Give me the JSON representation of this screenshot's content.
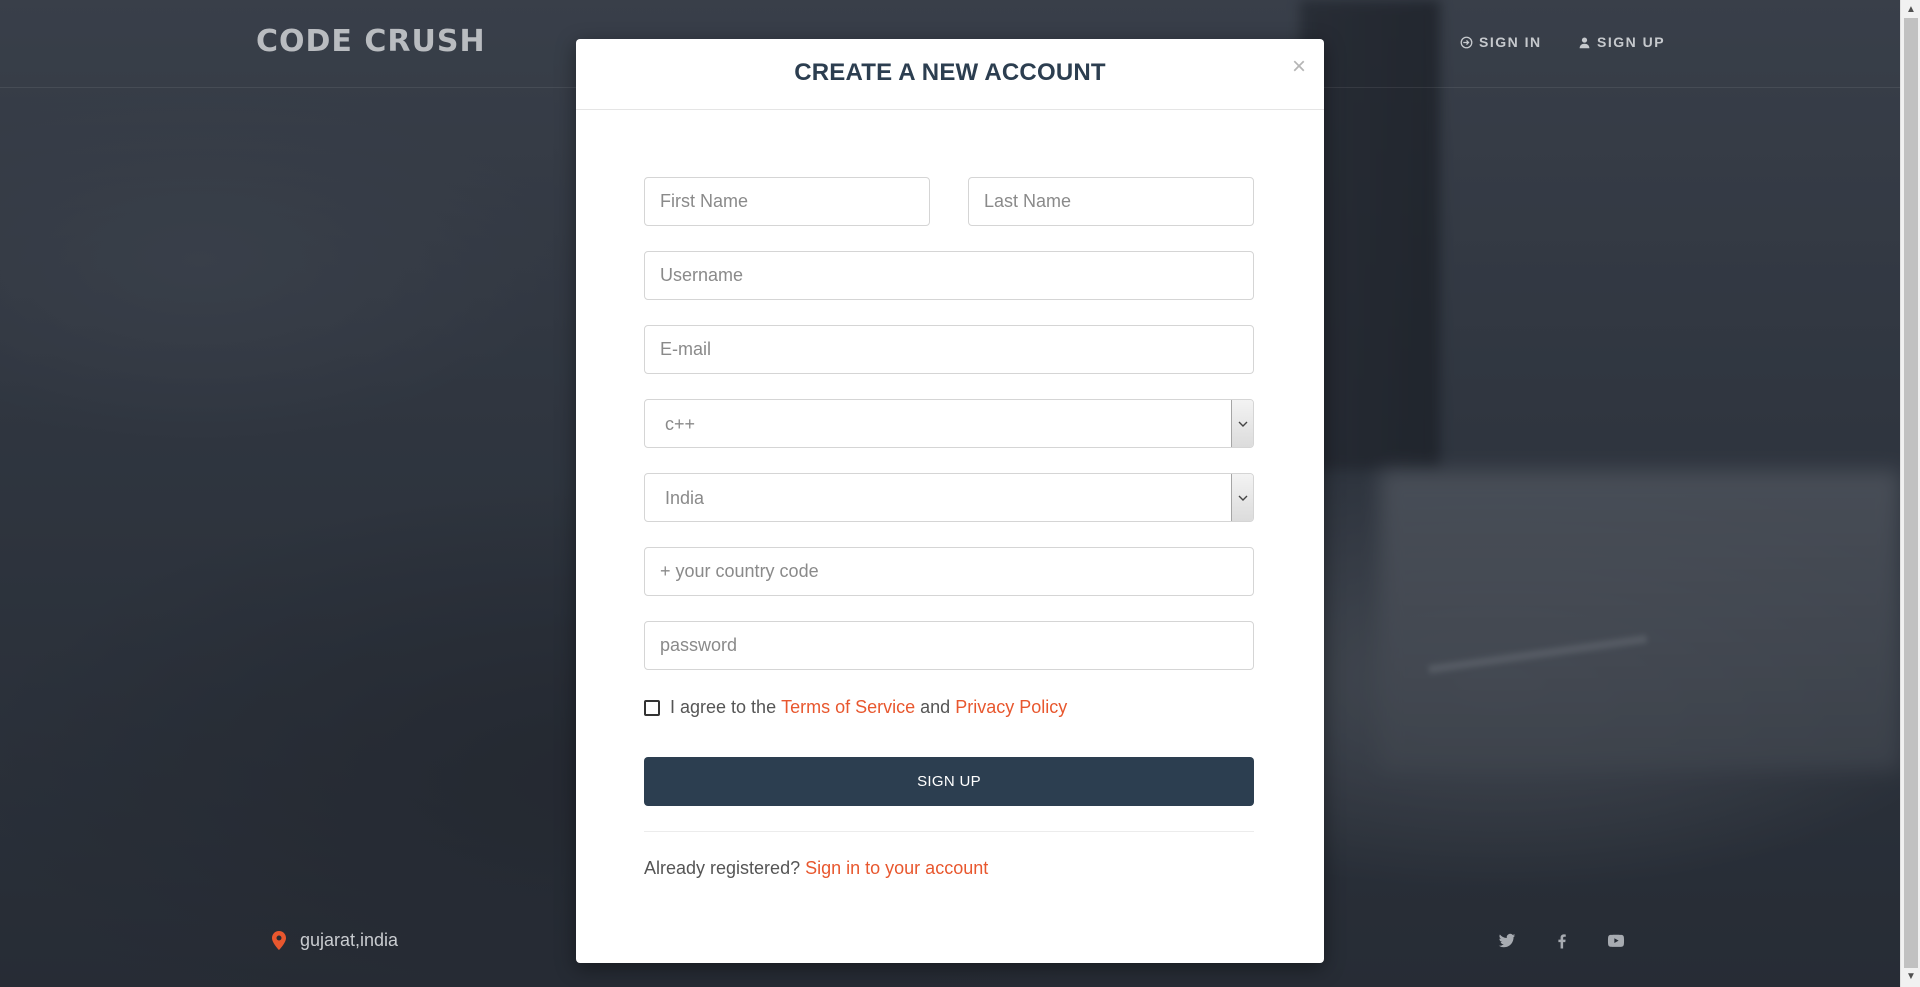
{
  "header": {
    "logo": "CODE CRUSH",
    "sign_in": "SIGN IN",
    "sign_up": "SIGN UP"
  },
  "footer": {
    "location": "gujarat,india",
    "social": [
      "twitter-icon",
      "facebook-icon",
      "youtube-icon"
    ]
  },
  "modal": {
    "title": "CREATE A NEW ACCOUNT",
    "close": "×",
    "first_name_placeholder": "First Name",
    "last_name_placeholder": "Last Name",
    "username_placeholder": "Username",
    "email_placeholder": "E-mail",
    "language_selected": "c++",
    "country_selected": "India",
    "country_code_placeholder": "+ your country code",
    "password_placeholder": "password",
    "agree_prefix": "I agree to the",
    "terms_link": "Terms of Service",
    "agree_and": "and",
    "privacy_link": "Privacy Policy",
    "submit": "SIGN UP",
    "already_text": "Already registered?",
    "signin_link": "Sign in to your account"
  },
  "colors": {
    "accent": "#e8572e",
    "primary": "#2c3e50"
  }
}
